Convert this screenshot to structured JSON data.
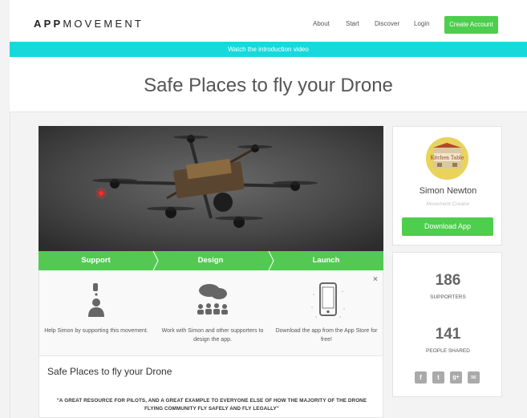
{
  "header": {
    "logo_bold": "APP",
    "logo_rest": "MOVEMENT",
    "nav": [
      "About",
      "Start",
      "Discover",
      "Login"
    ],
    "create_account": "Create Account"
  },
  "intro_bar": "Watch the introduction video",
  "page_title": "Safe Places to fly your Drone",
  "steps": [
    "Support",
    "Design",
    "Launch"
  ],
  "info_columns": [
    {
      "icon": "person-icon",
      "text": "Help Simon by supporting this movement."
    },
    {
      "icon": "discussion-group-icon",
      "text": "Work with Simon and other supporters to design the app."
    },
    {
      "icon": "smartphone-icon",
      "text": "Download the app from the App Store for free!"
    }
  ],
  "close_glyph": "×",
  "description": {
    "title": "Safe Places to fly your Drone",
    "quote": "\"A GREAT RESOURCE FOR PILOTS, AND A GREAT EXAMPLE TO EVERYONE ELSE OF HOW THE MAJORITY OF THE DRONE FLYING COMMUNITY FLY SAFELY AND FLY LEGALLY\""
  },
  "creator": {
    "name": "Simon Newton",
    "role": "Movement Creator",
    "avatar_text": "Kitchen Table",
    "download_button": "Download App"
  },
  "stats": [
    {
      "value": "186",
      "label": "SUPPORTERS"
    },
    {
      "value": "141",
      "label": "PEOPLE SHARED"
    }
  ],
  "social": [
    {
      "icon": "facebook-icon",
      "glyph": "f"
    },
    {
      "icon": "twitter-icon",
      "glyph": "t"
    },
    {
      "icon": "google-plus-icon",
      "glyph": "g+"
    },
    {
      "icon": "email-icon",
      "glyph": "✉"
    }
  ],
  "colors": {
    "accent_green": "#4dce4d",
    "intro_cyan": "#17d9dc",
    "background": "#f3f3f3"
  }
}
